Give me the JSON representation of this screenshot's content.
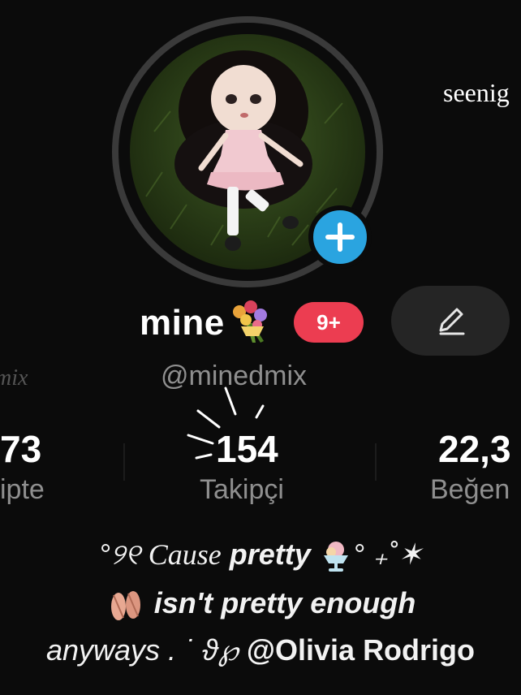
{
  "side_text_top": "seenig",
  "side_text_left": "mix",
  "profile": {
    "display_name": "mine",
    "display_name_emoji": "flower-bouquet-icon",
    "badge": "9+",
    "handle": "@minedmix"
  },
  "stats": [
    {
      "value": "73",
      "label": "ipte"
    },
    {
      "value": "154",
      "label": "Takipçi"
    },
    {
      "value": "22,3",
      "label": "Beğen"
    }
  ],
  "bio": {
    "line1": {
      "prefix": "°୨୧ ",
      "script": "Cause",
      "bold": " pretty ",
      "suffix": "° ₊˚✶"
    },
    "line2": {
      "text": " isn't pretty enough"
    },
    "line3": {
      "plain": "anyways . ˙ ϑ℘ ",
      "mention": "@Olivia Rodrigo"
    }
  },
  "colors": {
    "background": "#0b0b0b",
    "badge": "#ec3d51",
    "add_button": "#2aa4e0",
    "muted_text": "#8f8f8f"
  }
}
